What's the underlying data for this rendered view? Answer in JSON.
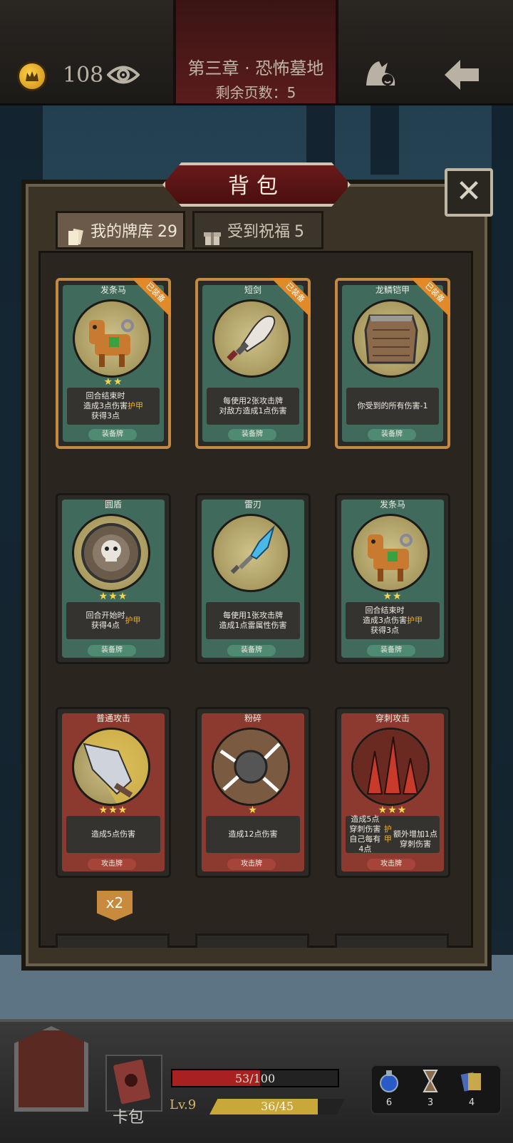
{
  "topbar": {
    "gold": "108",
    "chapter_title": "第三章 · 恐怖墓地",
    "pages_remaining": "剩余页数：5"
  },
  "panel": {
    "title": "背包",
    "close_label": "✕",
    "tabs": [
      {
        "label": "我的牌库",
        "count": "29"
      },
      {
        "label": "受到祝福",
        "count": "5"
      }
    ]
  },
  "cards": [
    {
      "name": "发条马",
      "stars": "★★",
      "desc": "回合结束时\n造成3点伤害\n获得3点",
      "desc_hl": "护甲",
      "type": "装备牌",
      "equipped_label": "已装备"
    },
    {
      "name": "短剑",
      "stars": "",
      "desc": "每使用2张攻击牌\n对敌方造成1点伤害",
      "desc_hl": "",
      "type": "装备牌",
      "equipped_label": "已装备"
    },
    {
      "name": "龙鳞铠甲",
      "stars": "",
      "desc": "你受到的所有伤害-1",
      "desc_hl": "",
      "type": "装备牌",
      "equipped_label": "已装备"
    },
    {
      "name": "圆盾",
      "stars": "★★★",
      "desc": "回合开始时\n获得4点",
      "desc_hl": "护甲",
      "type": "装备牌",
      "equipped_label": ""
    },
    {
      "name": "雷刃",
      "stars": "",
      "desc": "每使用1张攻击牌\n造成1点雷属性伤害",
      "desc_hl": "",
      "type": "装备牌",
      "equipped_label": ""
    },
    {
      "name": "发条马",
      "stars": "★★",
      "desc": "回合结束时\n造成3点伤害\n获得3点",
      "desc_hl": "护甲",
      "type": "装备牌",
      "equipped_label": ""
    },
    {
      "name": "普通攻击",
      "stars": "★★★",
      "desc": "造成5点伤害",
      "desc_hl": "",
      "type": "攻击牌",
      "equipped_label": ""
    },
    {
      "name": "粉碎",
      "stars": "★",
      "desc": "造成12点伤害",
      "desc_hl": "",
      "type": "攻击牌",
      "equipped_label": ""
    },
    {
      "name": "穿刺攻击",
      "stars": "★★★",
      "desc": "造成5点穿刺伤害\n自己每有4点",
      "desc_hl": "护甲",
      "desc_tail": "\n额外增加1点穿刺伤害",
      "type": "攻击牌",
      "equipped_label": ""
    }
  ],
  "count_badge": "x2",
  "bottom": {
    "cardbook_label": "卡包",
    "hp_text": "53/100",
    "hp_fraction": 0.53,
    "level": "Lv.9",
    "xp_text": "36/45",
    "xp_fraction": 0.8,
    "items": [
      {
        "icon": "potion-icon",
        "count": "6"
      },
      {
        "icon": "hourglass-icon",
        "count": "3"
      },
      {
        "icon": "cards-icon",
        "count": "4"
      }
    ]
  },
  "colors": {
    "accent_orange": "#e08a2a",
    "equip_green": "#3f6a5c",
    "attack_red": "#8c3a30",
    "armor_highlight": "#f0b02a"
  }
}
